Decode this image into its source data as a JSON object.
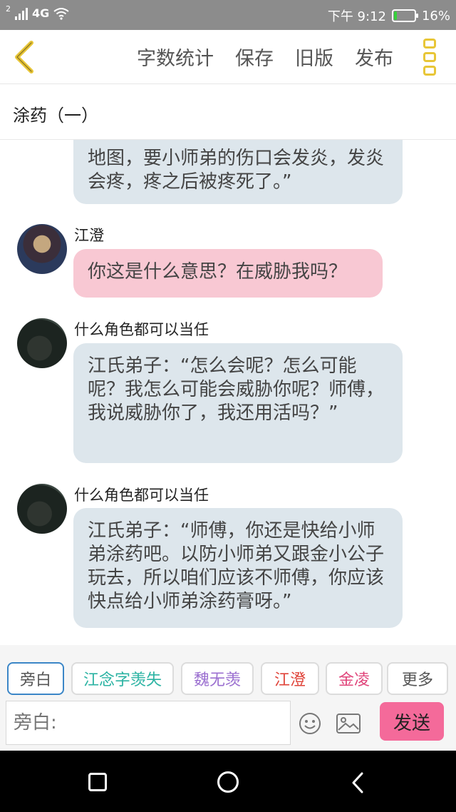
{
  "status_bar": {
    "sim_slot": "2",
    "network": "4G",
    "time": "下午 9:12",
    "battery": "16%",
    "battery_level": 0.16,
    "battery_color": "#36d13a"
  },
  "header": {
    "actions": [
      "字数统计",
      "保存",
      "旧版",
      "发布"
    ],
    "accent_color": "#e8c637"
  },
  "chapter": {
    "title": "涂药（一）"
  },
  "messages": [
    {
      "sender": "",
      "type": "blue",
      "text": "地图，要小师弟的伤口会发炎，发炎会疼，疼之后被疼死了。”"
    },
    {
      "sender": "江澄",
      "type": "pink",
      "text": "你这是什么意思？在威胁我吗？"
    },
    {
      "sender": "什么角色都可以当任",
      "type": "blue",
      "text": "江氏弟子：“怎么会呢？怎么可能呢？我怎么可能会威胁你呢？师傅，我说威胁你了，我还用活吗？”"
    },
    {
      "sender": "什么角色都可以当任",
      "type": "blue",
      "text": "江氏弟子：“师傅，你还是快给小师弟涂药吧。以防小师弟又跟金小公子玩去，所以咱们应该不师傅，你应该快点给小师弟涂药膏呀。”"
    }
  ],
  "roles": [
    {
      "label": "旁白",
      "color": "#555555"
    },
    {
      "label": "江念字羡失",
      "color": "#2bb3a3"
    },
    {
      "label": "魏无羡",
      "color": "#9b6fd0"
    },
    {
      "label": "江澄",
      "color": "#e0443a"
    },
    {
      "label": "金凌",
      "color": "#e0447a"
    },
    {
      "label": "更多",
      "color": "#555555"
    }
  ],
  "input": {
    "placeholder": "旁白:"
  },
  "send_label": "发送",
  "colors": {
    "bubble_blue": "#dde6ec",
    "bubble_pink": "#f8c8d3",
    "send_button": "#f46a9a",
    "active_tab_border": "#3b86c7"
  }
}
